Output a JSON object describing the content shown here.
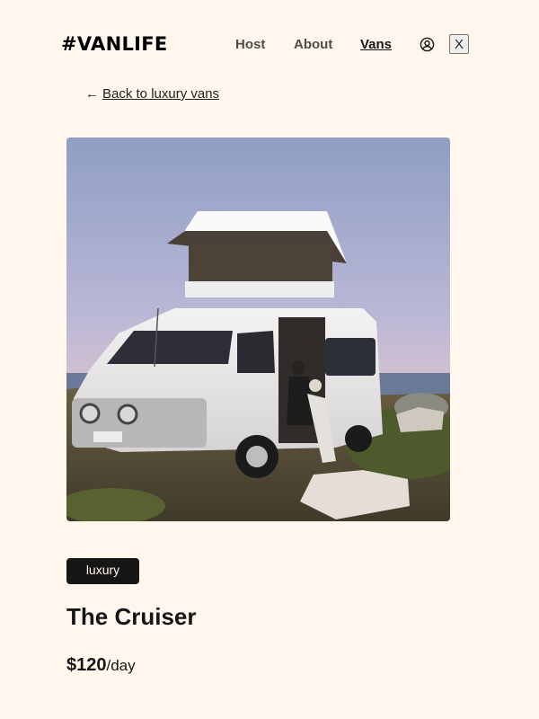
{
  "header": {
    "logo": "#VANLIFE",
    "nav": {
      "host": "Host",
      "about": "About",
      "vans": "Vans"
    },
    "close_label": "X"
  },
  "back_link": {
    "arrow": "←",
    "label": "Back to luxury vans"
  },
  "van": {
    "image_alt": "White camper van with rooftop tent parked by the coast",
    "type": "luxury",
    "name": "The Cruiser",
    "price": "$120",
    "price_unit": "/day"
  },
  "colors": {
    "background": "#fff7ed",
    "badge": "#161616",
    "text": "#161616"
  },
  "icons": {
    "user": "user-circle-icon",
    "back": "arrow-left-icon"
  }
}
